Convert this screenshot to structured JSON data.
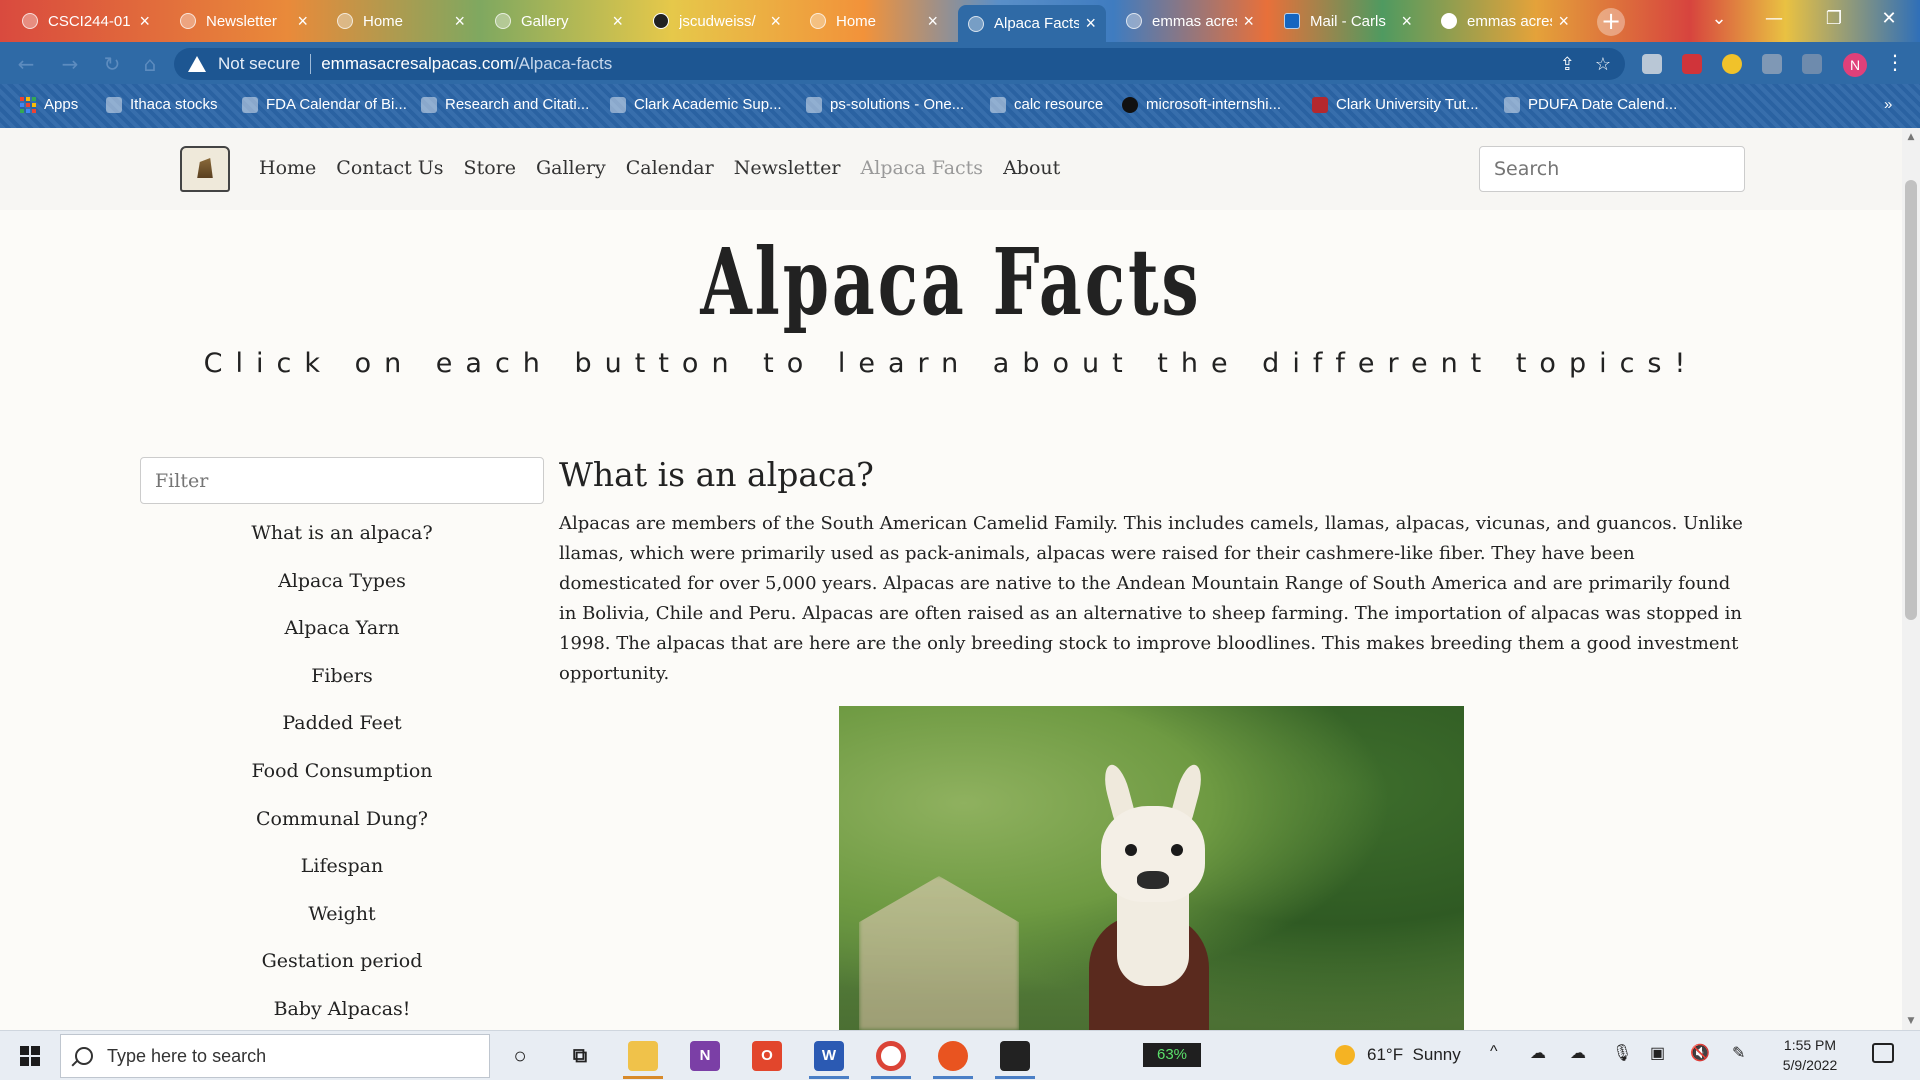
{
  "browser": {
    "tabs": [
      {
        "title": "CSCI244-01",
        "active": false,
        "color": "#d94a3e"
      },
      {
        "title": "Newsletter",
        "active": false,
        "color": "#7fa860"
      },
      {
        "title": "Home",
        "active": false,
        "color": "#e6a23a"
      },
      {
        "title": "Gallery",
        "active": false,
        "color": "#e9883a"
      },
      {
        "title": "jscudweiss/",
        "active": false,
        "color": "#e6c84a"
      },
      {
        "title": "Home",
        "active": false,
        "color": "#f2923a"
      },
      {
        "title": "Alpaca Facts",
        "active": true,
        "color": "#2f6aa6"
      },
      {
        "title": "emmas acres",
        "active": false,
        "color": "#e8703a"
      },
      {
        "title": "Mail - Carls",
        "active": false,
        "color": "#4f9a60"
      },
      {
        "title": "emmas acres",
        "active": false,
        "color": "#e4a23a"
      }
    ],
    "not_secure_label": "Not secure",
    "url_host": "emmasacresalpacas.com",
    "url_path": "/Alpaca-facts",
    "profile_initial": "N",
    "bookmarks": [
      "Apps",
      "Ithaca stocks",
      "FDA Calendar of Bi...",
      "Research and Citati...",
      "Clark Academic Sup...",
      "ps-solutions - One...",
      "calc resource",
      "microsoft-internshi...",
      "Clark University Tut...",
      "PDUFA Date Calend..."
    ]
  },
  "site": {
    "nav": [
      "Home",
      "Contact Us",
      "Store",
      "Gallery",
      "Calendar",
      "Newsletter",
      "Alpaca Facts",
      "About"
    ],
    "active_nav": "Alpaca Facts",
    "search_placeholder": "Search",
    "title": "Alpaca Facts",
    "subtitle": "Click on each button to learn about the different topics!",
    "filter_placeholder": "Filter",
    "topics": [
      "What is an alpaca?",
      "Alpaca Types",
      "Alpaca Yarn",
      "Fibers",
      "Padded Feet",
      "Food Consumption",
      "Communal Dung?",
      "Lifespan",
      "Weight",
      "Gestation period",
      "Baby Alpacas!"
    ],
    "content_heading": "What is an alpaca?",
    "content_body": "Alpacas are members of the South American Camelid Family. This includes camels, llamas, alpacas, vicunas, and guancos. Unlike llamas, which were primarily used as pack-animals, alpacas were raised for their cashmere-like fiber. They have been domesticated for over 5,000 years. Alpacas are native to the Andean Mountain Range of South America and are primarily found in Bolivia, Chile and Peru. Alpacas are often raised as an alternative to sheep farming. The importation of alpacas was stopped in 1998. The alpacas that are here are the only breeding stock to improve bloodlines. This makes breeding them a good investment opportunity."
  },
  "taskbar": {
    "search_placeholder": "Type here to search",
    "battery": "63%",
    "weather_temp": "61°F",
    "weather_cond": "Sunny",
    "time": "1:55 PM",
    "date": "5/9/2022"
  }
}
